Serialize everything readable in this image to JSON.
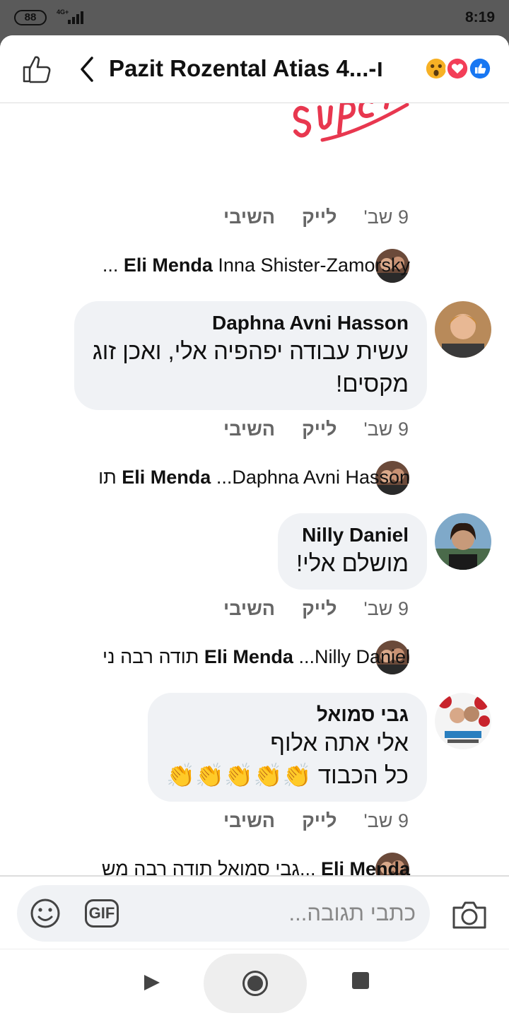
{
  "status_bar": {
    "battery": "88",
    "network": "4G+",
    "time": "8:19"
  },
  "header": {
    "title": "Pazit Rozental Atias 4...-ו"
  },
  "comments": [
    {
      "type": "sticker_footer",
      "date": "9 שב'",
      "like": "לייק",
      "reply": "השיבי"
    },
    {
      "type": "reply",
      "author": "Eli Menda",
      "text": "Inna Shister-Zamorsky ..."
    },
    {
      "type": "comment",
      "author": "Daphna Avni Hasson",
      "lines": [
        "עשית עבודה יפהפיה אלי, ואכן זוג",
        "מקסים!"
      ],
      "date": "9 שב'",
      "like": "לייק",
      "reply": "השיבי"
    },
    {
      "type": "reply",
      "author": "Eli Menda",
      "text": "...Daphna Avni Hasson תו"
    },
    {
      "type": "comment",
      "author": "Nilly Daniel",
      "lines": [
        "מושלם אלי!"
      ],
      "date": "9 שב'",
      "like": "לייק",
      "reply": "השיבי"
    },
    {
      "type": "reply",
      "author": "Eli Menda",
      "text": "...Nilly Daniel תודה רבה ני"
    },
    {
      "type": "comment",
      "author": "גבי סמואל",
      "lines": [
        "אלי אתה אלוף",
        "כל הכבוד 👏👏👏👏👏"
      ],
      "date": "9 שב'",
      "like": "לייק",
      "reply": "השיבי"
    },
    {
      "type": "reply",
      "author": "Eli Menda",
      "text": "...גבי סמואל תודה רבה מש"
    }
  ],
  "composer": {
    "placeholder": "כתבי תגובה...",
    "gif_label": "GIF"
  },
  "colors": {
    "accent": "#1877f2",
    "love": "#f33e58",
    "wow": "#f7b125",
    "bubble": "#f0f2f5"
  }
}
